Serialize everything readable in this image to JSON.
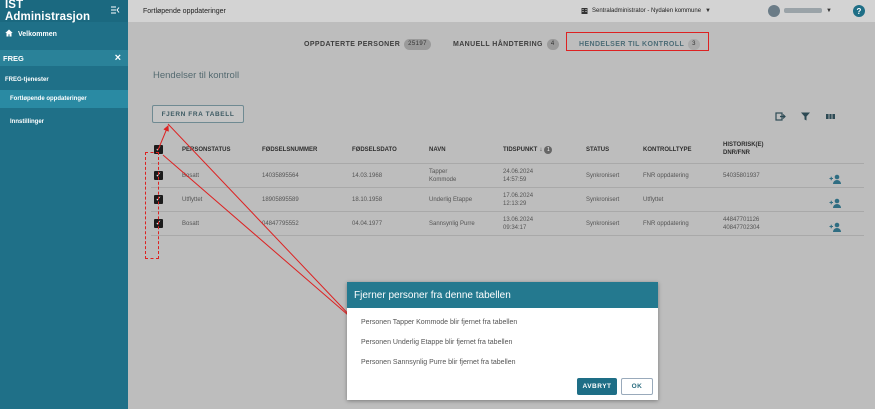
{
  "sidebar": {
    "app_title": "IST Administrasjon",
    "home_label": "Velkommen",
    "section_label": "FREG",
    "group_label": "FREG-tjenester",
    "items": [
      {
        "label": "Fortløpende oppdateringer",
        "active": true
      },
      {
        "label": "Innstillinger",
        "active": false
      }
    ]
  },
  "topbar": {
    "page_title": "Fortløpende oppdateringer",
    "admin_label": "Sentraladministrator - Nydalen kommune"
  },
  "tabs": [
    {
      "label": "OPPDATERTE PERSONER",
      "count": "25197"
    },
    {
      "label": "MANUELL HÅNDTERING",
      "count": "4"
    },
    {
      "label": "HENDELSER TIL KONTROLL",
      "count": "3"
    }
  ],
  "main": {
    "title": "Hendelser til kontroll",
    "remove_button": "FJERN FRA TABELL",
    "sort_badge": "1"
  },
  "table": {
    "headers": [
      "PERSONSTATUS",
      "FØDSELSNUMMER",
      "FØDSELSDATO",
      "NAVN",
      "TIDSPUNKT",
      "STATUS",
      "KONTROLLTYPE",
      "HISTORISK(E) DNR/FNR"
    ],
    "rows": [
      {
        "personstatus": "Bosatt",
        "fnr": "14035895564",
        "fdato": "14.03.1968",
        "navn": "Tapper Kommode",
        "tid_date": "24.06.2024",
        "tid_time": "14:57:59",
        "status": "Synkronisert",
        "kontrolltype": "FNR oppdatering",
        "historisk": "54035801937",
        "historisk2": ""
      },
      {
        "personstatus": "Utflyttet",
        "fnr": "18905895589",
        "fdato": "18.10.1958",
        "navn": "Underlig Etappe",
        "tid_date": "17.06.2024",
        "tid_time": "12:13:29",
        "status": "Synkronisert",
        "kontrolltype": "Utflyttet",
        "historisk": "",
        "historisk2": ""
      },
      {
        "personstatus": "Bosatt",
        "fnr": "04847795552",
        "fdato": "04.04.1977",
        "navn": "Sannsynlig Purre",
        "tid_date": "13.06.2024",
        "tid_time": "09:34:17",
        "status": "Synkronisert",
        "kontrolltype": "FNR oppdatering",
        "historisk": "44847701126",
        "historisk2": "40847702304"
      }
    ]
  },
  "dialog": {
    "title": "Fjerner personer fra denne tabellen",
    "lines": [
      "Personen Tapper Kommode blir fjernet fra tabellen",
      "Personen Underlig Etappe blir fjernet fra tabellen",
      "Personen Sannsynlig Purre blir fjernet fra tabellen"
    ],
    "cancel_label": "AVBRYT",
    "ok_label": "OK"
  }
}
